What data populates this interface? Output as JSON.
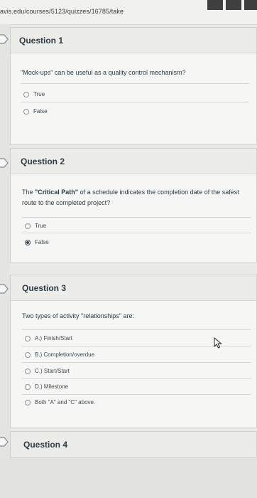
{
  "browser": {
    "url": "avis.edu/courses/5123/quizzes/16785/take"
  },
  "questions": [
    {
      "title": "Question 1",
      "text_plain": "\"Mock-ups\" can be useful as a quality control mechanism?",
      "options": [
        {
          "label": "True",
          "selected": false
        },
        {
          "label": "False",
          "selected": false
        }
      ]
    },
    {
      "title": "Question 2",
      "text_prefix": "The ",
      "text_bold": "\"Critical Path\"",
      "text_suffix_line1": " of a schedule indicates the completion date of the safest",
      "text_line2": "route to the completed project?",
      "options": [
        {
          "label": "True",
          "selected": false
        },
        {
          "label": "False",
          "selected": true
        }
      ]
    },
    {
      "title": "Question 3",
      "text_plain": "Two types of activity \"relationships\" are:",
      "options": [
        {
          "label": "A.) Finish/Start",
          "selected": false
        },
        {
          "label": "B.) Completion/overdue",
          "selected": false
        },
        {
          "label": "C.) Start/Start",
          "selected": false
        },
        {
          "label": "D.) Milestone",
          "selected": false
        },
        {
          "label": "Both \"A\" and \"C\" above.",
          "selected": false
        }
      ]
    },
    {
      "title": "Question 4"
    }
  ],
  "colors": {
    "page_bg": "#e9e9e7",
    "card_bg": "#f6f6f4",
    "text": "#2d3b45"
  },
  "icons": {
    "question_flag": "flag-icon",
    "cursor": "mouse-pointer-icon"
  }
}
